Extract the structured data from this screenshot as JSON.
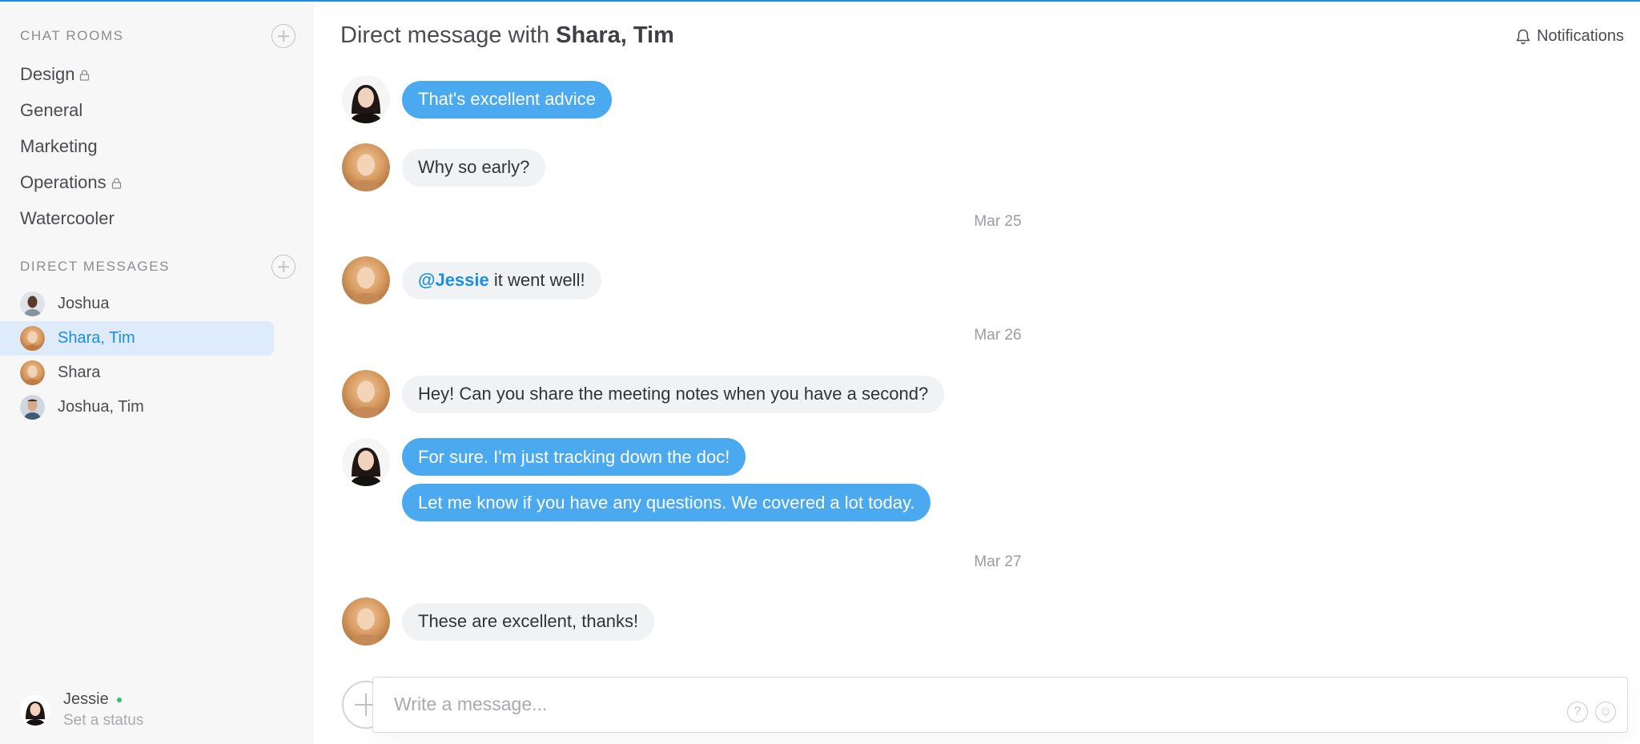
{
  "sidebar": {
    "chat_rooms_title": "CHAT ROOMS",
    "rooms": [
      {
        "label": "Design",
        "locked": true
      },
      {
        "label": "General",
        "locked": false
      },
      {
        "label": "Marketing",
        "locked": false
      },
      {
        "label": "Operations",
        "locked": true
      },
      {
        "label": "Watercooler",
        "locked": false
      }
    ],
    "direct_messages_title": "DIRECT MESSAGES",
    "dms": [
      {
        "label": "Joshua",
        "active": false
      },
      {
        "label": "Shara, Tim",
        "active": true
      },
      {
        "label": "Shara",
        "active": false
      },
      {
        "label": "Joshua, Tim",
        "active": false
      }
    ],
    "me": {
      "name": "Jessie",
      "status_placeholder": "Set a status",
      "online": true
    }
  },
  "header": {
    "title_prefix": "Direct message with",
    "title_people": "Shara, Tim",
    "notifications_label": "Notifications"
  },
  "messages": [
    {
      "author": "Jessie",
      "direction": "out",
      "text": "That's excellent advice"
    },
    {
      "author": "Shara",
      "direction": "in",
      "text": "Why so early?"
    },
    {
      "date": "Mar 25"
    },
    {
      "author": "Shara",
      "direction": "in",
      "mention": "@Jessie",
      "text": " it went well!"
    },
    {
      "date": "Mar 26"
    },
    {
      "author": "Shara",
      "direction": "in",
      "text": "Hey! Can you share the meeting notes when you have a second?"
    },
    {
      "author": "Jessie",
      "direction": "out",
      "text": "For sure. I'm just tracking down the doc!"
    },
    {
      "author": "Jessie",
      "direction": "out",
      "text": "Let me know if you have any questions. We covered a lot today."
    },
    {
      "date": "Mar 27"
    },
    {
      "author": "Shara",
      "direction": "in",
      "text": "These are excellent, thanks!"
    }
  ],
  "composer": {
    "placeholder": "Write a message...",
    "help_icon": "?",
    "emoji_icon": "☺"
  },
  "colors": {
    "accent": "#1a8fe3",
    "outgoing_bubble": "#4aa9ef",
    "incoming_bubble": "#f1f2f4",
    "sidebar_bg": "#f7f7f8",
    "active_dm_bg": "#deebfb",
    "online": "#2fc76a"
  }
}
